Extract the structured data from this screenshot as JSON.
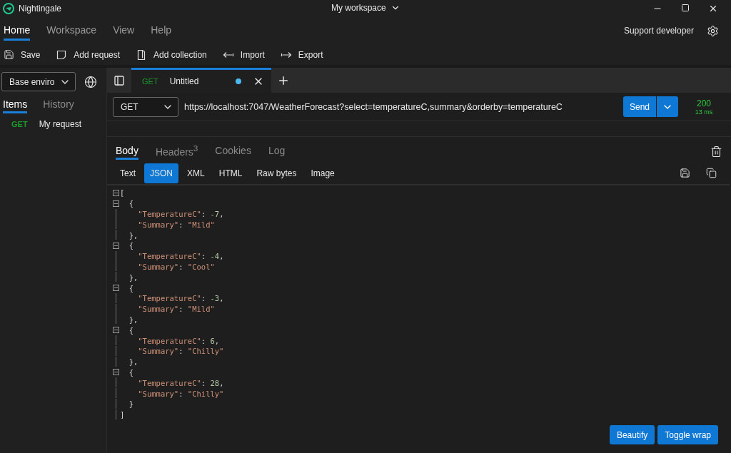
{
  "app": {
    "name": "Nightingale"
  },
  "workspace": {
    "label": "My workspace"
  },
  "menu": [
    {
      "label": "Home",
      "selected": true
    },
    {
      "label": "Workspace",
      "selected": false
    },
    {
      "label": "View",
      "selected": false
    },
    {
      "label": "Help",
      "selected": false
    }
  ],
  "support_link": "Support developer",
  "toolbar": [
    {
      "kind": "save",
      "label": "Save"
    },
    {
      "kind": "request",
      "label": "Add request"
    },
    {
      "kind": "collection",
      "label": "Add collection"
    },
    {
      "kind": "import",
      "label": "Import"
    },
    {
      "kind": "export",
      "label": "Export"
    }
  ],
  "environment": {
    "value": "Base enviro"
  },
  "sidebar": {
    "tabs": [
      {
        "label": "Items",
        "selected": true
      },
      {
        "label": "History",
        "selected": false
      }
    ],
    "items": [
      {
        "method": "GET",
        "name": "My request"
      }
    ]
  },
  "request_tabs": [
    {
      "method": "GET",
      "title": "Untitled",
      "selected": true,
      "unsaved": true
    }
  ],
  "request": {
    "method": "GET",
    "url": "https://localhost:7047/WeatherForecast?select=temperatureC,summary&orderby=temperatureC",
    "send": "Send"
  },
  "response": {
    "status": "200",
    "time": "13 ms",
    "tabs": [
      {
        "label": "Body",
        "selected": true
      },
      {
        "label": "Headers$^{3}$",
        "selected": false
      },
      {
        "label": "Cookies",
        "selected": false
      },
      {
        "label": "Log",
        "selected": false
      }
    ],
    "formats": [
      {
        "label": "Text",
        "selected": false
      },
      {
        "label": "JSON",
        "selected": true
      },
      {
        "label": "XML",
        "selected": false
      },
      {
        "label": "HTML",
        "selected": false
      },
      {
        "label": "Raw bytes",
        "selected": false
      },
      {
        "label": "Image",
        "selected": false
      }
    ],
    "lines": [
      {
        "text": "[",
        "fold": true
      },
      {
        "text": "  {",
        "fold": true
      },
      {
        "text": "    \"TemperatureC\": -7,",
        "fold": false
      },
      {
        "text": "    \"Summary\": \"Mild\"",
        "fold": false
      },
      {
        "text": "  },",
        "fold": false
      },
      {
        "text": "  {",
        "fold": true
      },
      {
        "text": "    \"TemperatureC\": -4,",
        "fold": false
      },
      {
        "text": "    \"Summary\": \"Cool\"",
        "fold": false
      },
      {
        "text": "  },",
        "fold": false
      },
      {
        "text": "  {",
        "fold": true
      },
      {
        "text": "    \"TemperatureC\": -3,",
        "fold": false
      },
      {
        "text": "    \"Summary\": \"Mild\"",
        "fold": false
      },
      {
        "text": "  },",
        "fold": false
      },
      {
        "text": "  {",
        "fold": true
      },
      {
        "text": "    \"TemperatureC\": 6,",
        "fold": false
      },
      {
        "text": "    \"Summary\": \"Chilly\"",
        "fold": false
      },
      {
        "text": "  },",
        "fold": false
      },
      {
        "text": "  {",
        "fold": true
      },
      {
        "text": "    \"TemperatureC\": 28,",
        "fold": false
      },
      {
        "text": "    \"Summary\": \"Chilly\"",
        "fold": false
      },
      {
        "text": "  }",
        "fold": false
      },
      {
        "text": "]",
        "fold": false
      }
    ],
    "buttons": [
      "Beautify",
      "Toggle wrap"
    ]
  }
}
